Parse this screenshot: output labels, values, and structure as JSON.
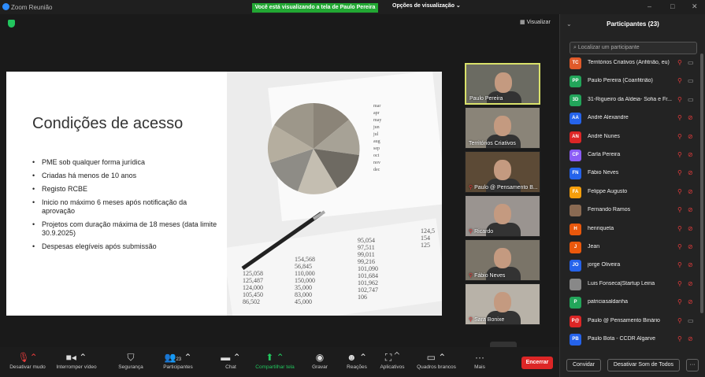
{
  "app": {
    "title": "Zoom Reunião"
  },
  "banner": {
    "viewing": "Você está visualizando a tela de Paulo Pereira",
    "view_options": "Opções de visualização ⌄"
  },
  "stage": {
    "visualizar": "Visualizar"
  },
  "slide": {
    "title": "Condições de acesso",
    "bullets": [
      "PME sob qualquer forma jurídica",
      "Criadas há menos de 10 anos",
      "Registo RCBE",
      "Inicio no máximo 6 meses após notificação da aprovação",
      "Projetos com duração máxima de 18 meses (data limite 30.9.2025)",
      "Despesas elegíveis após submissão"
    ],
    "table_col1": [
      "125,058",
      "125,487",
      "124,000",
      "105,450",
      "86,502"
    ],
    "table_col2": [
      "154,568",
      "56,845",
      "110,000",
      "150,000",
      "35,000",
      "83,000",
      "45,000"
    ],
    "table_col3": [
      "95,054",
      "97,511",
      "99,011",
      "99,216",
      "101,090",
      "101,684",
      "101,962",
      "102,747",
      "106"
    ],
    "table_col4": [
      "124,5",
      "154",
      "125"
    ],
    "legend": [
      "mar",
      "apr",
      "may",
      "jun",
      "jul",
      "aug",
      "sep",
      "oct",
      "nov",
      "dec"
    ]
  },
  "tiles": [
    {
      "name": "Paulo Pereira",
      "active": true
    },
    {
      "name": "Territórios Criativos"
    },
    {
      "name": "Paulo @ Pensamento B..."
    },
    {
      "name": "Ricardo"
    },
    {
      "name": "Fábio Neves"
    },
    {
      "name": "Sara Bonixe"
    }
  ],
  "toolbar": {
    "items": [
      "Desativar mudo",
      "Interromper vídeo",
      "Segurança",
      "Participantes",
      "Chat",
      "Compartilhar tela",
      "Gravar",
      "Reações",
      "Aplicativos",
      "Quadros brancos",
      "Mais"
    ],
    "participants_count": "23",
    "end": "Encerrar"
  },
  "panel": {
    "title": "Participantes (23)",
    "search_placeholder": "Localizar um participante",
    "participants": [
      {
        "initials": "TC",
        "name": "Territórios Criativos (Anfitrião, eu)",
        "color": "#e05a2a",
        "video": "on"
      },
      {
        "initials": "PP",
        "name": "Paulo Pereira (Coanfitrião)",
        "color": "#22a55a",
        "video": "on"
      },
      {
        "initials": "3D",
        "name": "31-Rigueiro da Aldeia- Sofia e Fr...",
        "color": "#22a55a",
        "video": "on"
      },
      {
        "initials": "AA",
        "name": "André Alexandre",
        "color": "#2563eb",
        "video": "off"
      },
      {
        "initials": "AN",
        "name": "André Nunes",
        "color": "#dc2626",
        "video": "off"
      },
      {
        "initials": "CP",
        "name": "Carla Pereira",
        "color": "#8b5cf6",
        "video": "off"
      },
      {
        "initials": "FN",
        "name": "Fábio Neves",
        "color": "#2563eb",
        "video": "off"
      },
      {
        "initials": "FA",
        "name": "Felippe Augusto",
        "color": "#f59e0b",
        "video": "off"
      },
      {
        "initials": "",
        "name": "Fernando Ramos",
        "color": "#8a6a52",
        "video": "off"
      },
      {
        "initials": "H",
        "name": "henriqueta",
        "color": "#ea580c",
        "video": "off"
      },
      {
        "initials": "J",
        "name": "Jean",
        "color": "#ea580c",
        "video": "off"
      },
      {
        "initials": "JO",
        "name": "jorge Oliveira",
        "color": "#2563eb",
        "video": "off"
      },
      {
        "initials": "",
        "name": "Luis Fonseca|Startup Leiria",
        "color": "#888888",
        "video": "off"
      },
      {
        "initials": "P",
        "name": "patriciasaldanha",
        "color": "#22a55a",
        "video": "off"
      },
      {
        "initials": "P@",
        "name": "Paulo @ Pensamento Binário",
        "color": "#dc2626",
        "video": "on"
      },
      {
        "initials": "PB",
        "name": "Paulo Bota - CCDR Algarve",
        "color": "#2563eb",
        "video": "off"
      }
    ],
    "invite": "Convidar",
    "mute_all": "Desativar Som de Todos",
    "more": "···"
  }
}
